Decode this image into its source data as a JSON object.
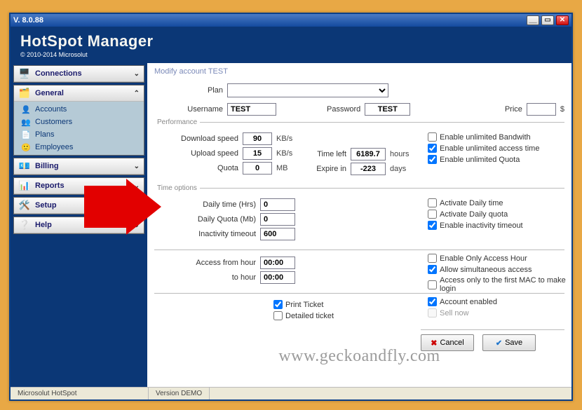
{
  "window": {
    "title_version": "V.   8.0.88",
    "app_title": "HotSpot Manager",
    "copyright": "© 2010-2014 Microsolut"
  },
  "sidebar": {
    "connections": {
      "label": "Connections"
    },
    "general": {
      "label": "General",
      "items": [
        {
          "icon": "👤",
          "label": "Accounts"
        },
        {
          "icon": "👥",
          "label": "Customers"
        },
        {
          "icon": "📄",
          "label": "Plans"
        },
        {
          "icon": "🙂",
          "label": "Employees"
        }
      ]
    },
    "billing": {
      "label": "Billing"
    },
    "reports": {
      "label": "Reports"
    },
    "setup": {
      "label": "Setup"
    },
    "help": {
      "label": "Help"
    }
  },
  "form": {
    "breadcrumb": "Modify account   TEST",
    "plan_label": "Plan",
    "username_label": "Username",
    "username_value": "TEST",
    "password_label": "Password",
    "password_value": "TEST",
    "price_label": "Price",
    "price_value": "",
    "currency": "$",
    "performance": {
      "legend": "Performance",
      "download_label": "Download speed",
      "download_value": "90",
      "download_unit": "KB/s",
      "upload_label": "Upload speed",
      "upload_value": "15",
      "upload_unit": "KB/s",
      "quota_label": "Quota",
      "quota_value": "0",
      "quota_unit": "MB",
      "timeleft_label": "Time left",
      "timeleft_value": "6189.7",
      "timeleft_unit": "hours",
      "expire_label": "Expire in",
      "expire_value": "-223",
      "expire_unit": "days",
      "cb_bandwith": "Enable unlimited Bandwith",
      "cb_bandwith_checked": false,
      "cb_accesstime": "Enable unlimited access time",
      "cb_accesstime_checked": true,
      "cb_quota": "Enable unlimited Quota",
      "cb_quota_checked": true
    },
    "timeoptions": {
      "legend": "Time options",
      "daily_time_label": "Daily time (Hrs)",
      "daily_time_value": "0",
      "daily_quota_label": "Daily Quota (Mb)",
      "daily_quota_value": "0",
      "inactivity_label": "Inactivity timeout",
      "inactivity_value": "600",
      "cb_daily_time": "Activate Daily time",
      "cb_daily_time_checked": false,
      "cb_daily_quota": "Activate Daily quota",
      "cb_daily_quota_checked": false,
      "cb_inactivity": "Enable inactivity timeout",
      "cb_inactivity_checked": true
    },
    "access": {
      "from_label": "Access from hour",
      "from_value": "00:00",
      "to_label": "to hour",
      "to_value": "00:00",
      "cb_only_access": "Enable Only Access Hour",
      "cb_only_access_checked": false,
      "cb_simultaneous": "Allow simultaneous access",
      "cb_simultaneous_checked": true,
      "cb_mac": "Access only to the first MAC to make login",
      "cb_mac_checked": false
    },
    "bottom": {
      "cb_print": "Print Ticket",
      "cb_print_checked": true,
      "cb_detailed": "Detailed ticket",
      "cb_detailed_checked": false,
      "cb_enabled": "Account enabled",
      "cb_enabled_checked": true,
      "cb_sell": "Sell now",
      "cb_sell_checked": false
    },
    "buttons": {
      "cancel": "Cancel",
      "save": "Save"
    }
  },
  "statusbar": {
    "left": "Microsolut HotSpot",
    "right": "Version DEMO"
  },
  "watermark": "www.geckoandfly.com"
}
